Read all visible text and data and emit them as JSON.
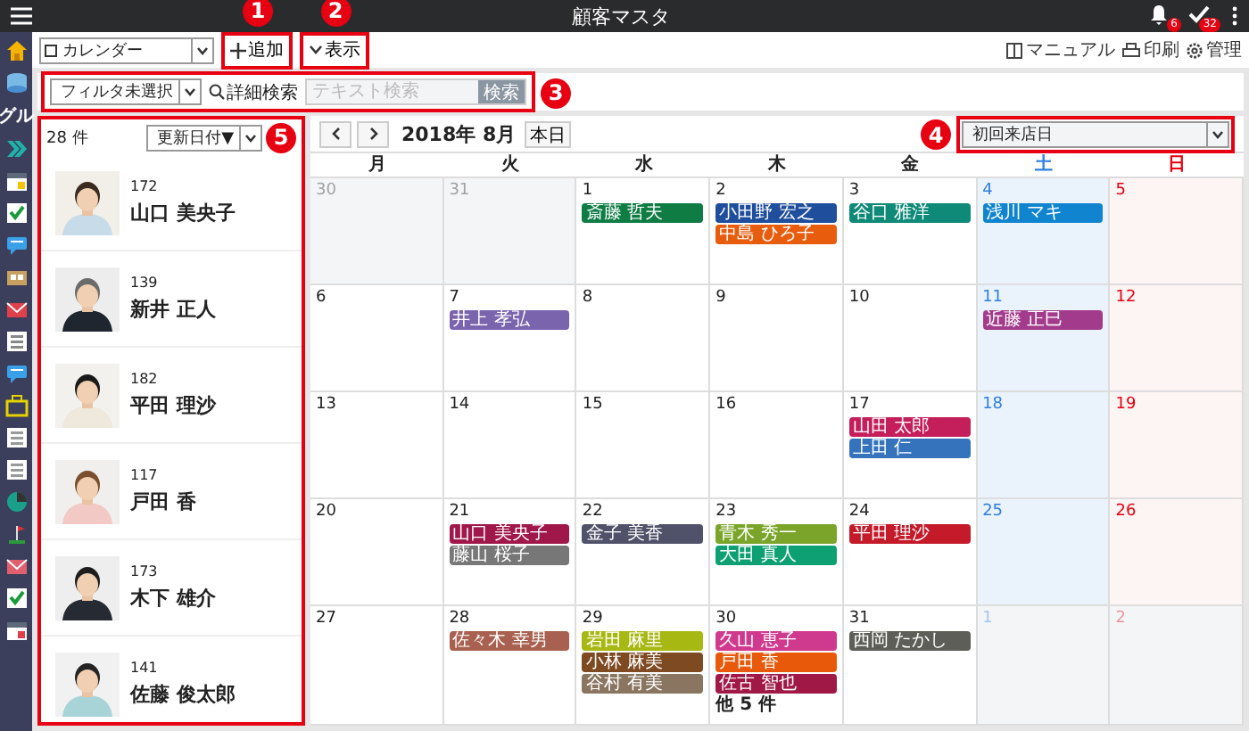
{
  "app_bar": {
    "title": "顧客マスタ",
    "notification_badge": "6",
    "task_badge": "32"
  },
  "rail": {
    "label": "グル"
  },
  "toolbar": {
    "view_select": "カレンダー",
    "add_button": {
      "label": "追加",
      "callout": "1"
    },
    "display_button": {
      "label": "表示",
      "callout": "2"
    },
    "links": [
      {
        "label": "マニュアル",
        "kind": "manual"
      },
      {
        "label": "印刷",
        "kind": "print"
      },
      {
        "label": "管理",
        "kind": "settings"
      }
    ]
  },
  "filter_bar": {
    "callout": "3",
    "filter_select": "フィルタ未選択",
    "advanced_search": "詳細検索",
    "search_placeholder": "テキスト検索",
    "search_button": "検索"
  },
  "customer_list": {
    "callout": "5",
    "count": "28 件",
    "sort_select": "更新日付▼",
    "customers": [
      {
        "number": "172",
        "name": "山口 美央子"
      },
      {
        "number": "139",
        "name": "新井 正人"
      },
      {
        "number": "182",
        "name": "平田 理沙"
      },
      {
        "number": "117",
        "name": "戸田 香"
      },
      {
        "number": "173",
        "name": "木下 雄介"
      },
      {
        "number": "141",
        "name": "佐藤 俊太郎"
      }
    ]
  },
  "calendar": {
    "month": "2018年 8月",
    "today_button": "本日",
    "date_field": {
      "value": "初回来店日",
      "callout": "4"
    },
    "weekdays": [
      {
        "label": "月",
        "kind": "weekday"
      },
      {
        "label": "火",
        "kind": "weekday"
      },
      {
        "label": "水",
        "kind": "weekday"
      },
      {
        "label": "木",
        "kind": "weekday"
      },
      {
        "label": "金",
        "kind": "weekday"
      },
      {
        "label": "土",
        "kind": "saturday"
      },
      {
        "label": "日",
        "kind": "sunday"
      }
    ],
    "weeks": [
      [
        {
          "day": "30",
          "other_month": true
        },
        {
          "day": "31",
          "other_month": true
        },
        {
          "day": "1",
          "other_month": false,
          "events": [
            {
              "name": "斎藤 哲夫",
              "color": "#0f7c44"
            }
          ]
        },
        {
          "day": "2",
          "other_month": false,
          "events": [
            {
              "name": "小田野 宏之",
              "color": "#1f4e9c"
            },
            {
              "name": "中島 ひろ子",
              "color": "#e85c0d"
            }
          ]
        },
        {
          "day": "3",
          "other_month": false,
          "events": [
            {
              "name": "谷口 雅洋",
              "color": "#0f8a78"
            }
          ]
        },
        {
          "day": "4",
          "other_month": false,
          "events": [
            {
              "name": "浅川 マキ",
              "color": "#1184cf"
            }
          ]
        },
        {
          "day": "5",
          "other_month": false
        }
      ],
      [
        {
          "day": "6",
          "other_month": false
        },
        {
          "day": "7",
          "other_month": false,
          "events": [
            {
              "name": "井上 孝弘",
              "color": "#7a64ae"
            }
          ]
        },
        {
          "day": "8",
          "other_month": false
        },
        {
          "day": "9",
          "other_month": false
        },
        {
          "day": "10",
          "other_month": false
        },
        {
          "day": "11",
          "other_month": false,
          "events": [
            {
              "name": "近藤 正巳",
              "color": "#a33b8c"
            }
          ]
        },
        {
          "day": "12",
          "other_month": false
        }
      ],
      [
        {
          "day": "13",
          "other_month": false
        },
        {
          "day": "14",
          "other_month": false
        },
        {
          "day": "15",
          "other_month": false
        },
        {
          "day": "16",
          "other_month": false
        },
        {
          "day": "17",
          "other_month": false,
          "events": [
            {
              "name": "山田 太郎",
              "color": "#c41f5a"
            },
            {
              "name": "上田 仁",
              "color": "#3573bd"
            }
          ]
        },
        {
          "day": "18",
          "other_month": false
        },
        {
          "day": "19",
          "other_month": false
        }
      ],
      [
        {
          "day": "20",
          "other_month": false
        },
        {
          "day": "21",
          "other_month": false,
          "events": [
            {
              "name": "山口 美央子",
              "color": "#a0184a"
            },
            {
              "name": "藤山 桜子",
              "color": "#777777"
            }
          ]
        },
        {
          "day": "22",
          "other_month": false,
          "events": [
            {
              "name": "金子 美香",
              "color": "#50526a"
            }
          ]
        },
        {
          "day": "23",
          "other_month": false,
          "events": [
            {
              "name": "青木 秀一",
              "color": "#7aa52a"
            },
            {
              "name": "大田 真人",
              "color": "#0ea072"
            }
          ]
        },
        {
          "day": "24",
          "other_month": false,
          "events": [
            {
              "name": "平田 理沙",
              "color": "#c41a2a"
            }
          ]
        },
        {
          "day": "25",
          "other_month": false
        },
        {
          "day": "26",
          "other_month": false
        }
      ],
      [
        {
          "day": "27",
          "other_month": false
        },
        {
          "day": "28",
          "other_month": false,
          "events": [
            {
              "name": "佐々木 幸男",
              "color": "#a86050"
            }
          ]
        },
        {
          "day": "29",
          "other_month": false,
          "events": [
            {
              "name": "岩田 麻里",
              "color": "#a8b812"
            },
            {
              "name": "小林 麻美",
              "color": "#7e4a22"
            },
            {
              "name": "谷村 有美",
              "color": "#8a7560"
            }
          ]
        },
        {
          "day": "30",
          "other_month": false,
          "events": [
            {
              "name": "久山 恵子",
              "color": "#d03a8e"
            },
            {
              "name": "戸田 香",
              "color": "#e85a0a"
            },
            {
              "name": "佐古 智也",
              "color": "#a01846"
            }
          ],
          "more": "他 5 件"
        },
        {
          "day": "31",
          "other_month": false,
          "events": [
            {
              "name": "西岡 たかし",
              "color": "#5e5e58"
            }
          ]
        },
        {
          "day": "1",
          "other_month": true
        },
        {
          "day": "2",
          "other_month": true
        }
      ]
    ]
  }
}
